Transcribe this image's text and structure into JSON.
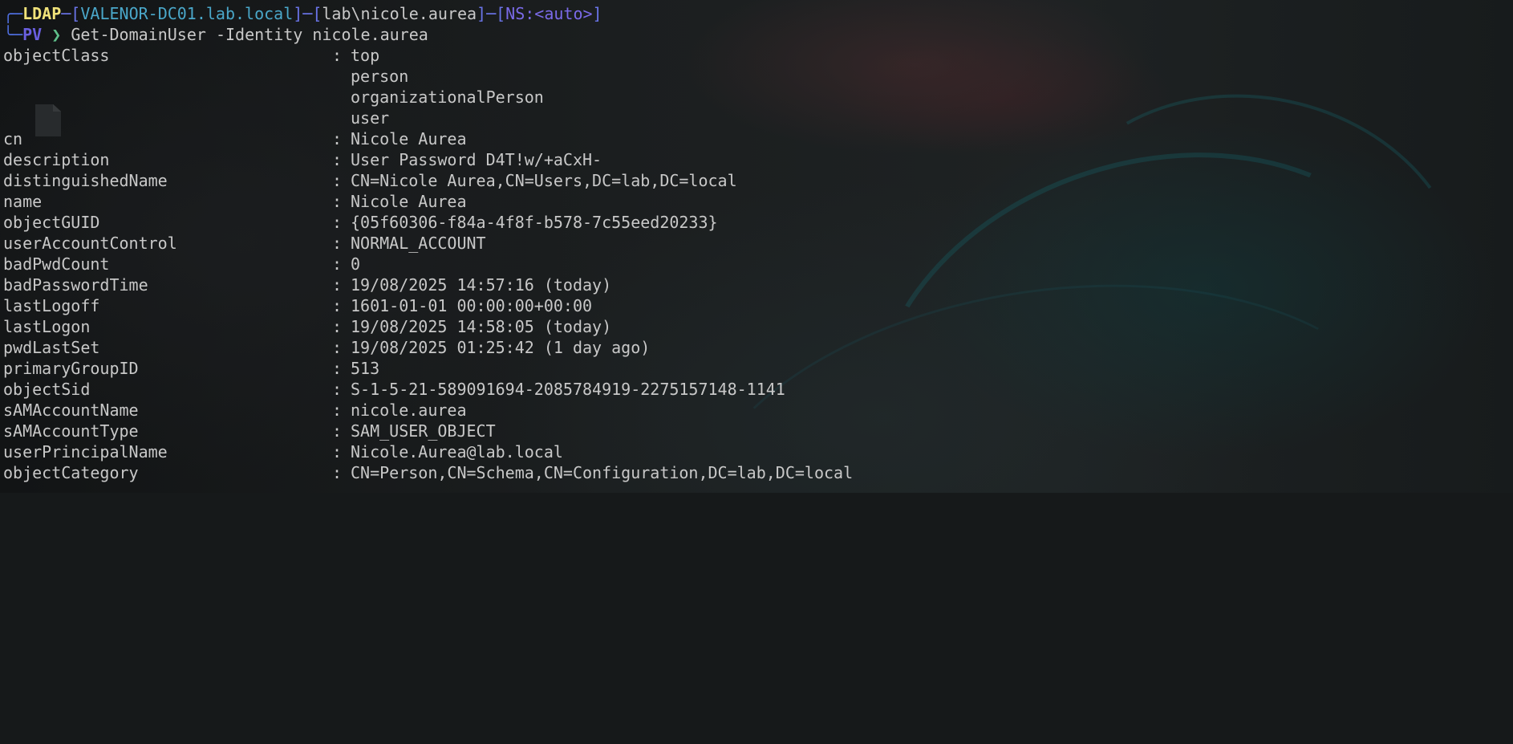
{
  "prompt": {
    "ldap": "LDAP",
    "host": "VALENOR-DC01.lab.local",
    "user": "lab\\nicole.aurea",
    "ns": "NS:<auto>",
    "mode": "PV",
    "chevron": "❯",
    "command": "Get-DomainUser -Identity nicole.aurea"
  },
  "output": {
    "separator": ":",
    "object_class_key": "objectClass",
    "object_class_values": [
      "top",
      "person",
      "organizationalPerson",
      "user"
    ],
    "rows": [
      {
        "key": "cn",
        "value": "Nicole Aurea"
      },
      {
        "key": "description",
        "value": "User Password D4T!w/+aCxH-"
      },
      {
        "key": "distinguishedName",
        "value": "CN=Nicole Aurea,CN=Users,DC=lab,DC=local"
      },
      {
        "key": "name",
        "value": "Nicole Aurea"
      },
      {
        "key": "objectGUID",
        "value": "{05f60306-f84a-4f8f-b578-7c55eed20233}"
      },
      {
        "key": "userAccountControl",
        "value": "NORMAL_ACCOUNT"
      },
      {
        "key": "badPwdCount",
        "value": "0"
      },
      {
        "key": "badPasswordTime",
        "value": "19/08/2025 14:57:16 (today)"
      },
      {
        "key": "lastLogoff",
        "value": "1601-01-01 00:00:00+00:00"
      },
      {
        "key": "lastLogon",
        "value": "19/08/2025 14:58:05 (today)"
      },
      {
        "key": "pwdLastSet",
        "value": "19/08/2025 01:25:42 (1 day ago)"
      },
      {
        "key": "primaryGroupID",
        "value": "513"
      },
      {
        "key": "objectSid",
        "value": "S-1-5-21-589091694-2085784919-2275157148-1141"
      },
      {
        "key": "sAMAccountName",
        "value": "nicole.aurea"
      },
      {
        "key": "sAMAccountType",
        "value": "SAM_USER_OBJECT"
      },
      {
        "key": "userPrincipalName",
        "value": "Nicole.Aurea@lab.local"
      },
      {
        "key": "objectCategory",
        "value": "CN=Person,CN=Schema,CN=Configuration,DC=lab,DC=local"
      }
    ]
  },
  "colors": {
    "background": "#16191a",
    "text": "#c8c8c8",
    "ldap": "#f0e27a",
    "host": "#4aa7c9",
    "bracket": "#6a74e8",
    "mode": "#6a5fe0",
    "chevron": "#5fbf8a"
  },
  "icons": {
    "desktop_file": "file-icon"
  }
}
